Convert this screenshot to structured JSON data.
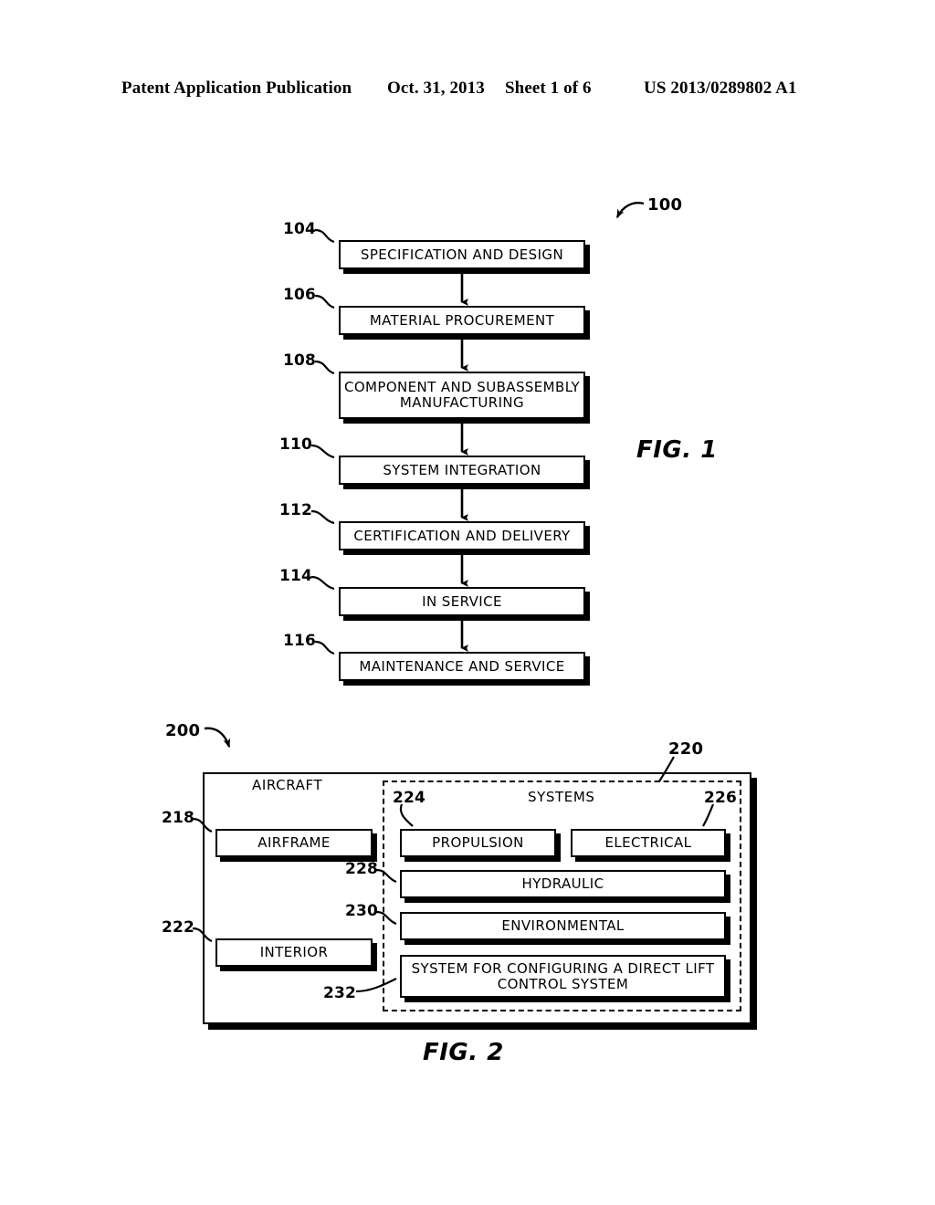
{
  "header": {
    "publication": "Patent Application Publication",
    "date": "Oct. 31, 2013",
    "sheet": "Sheet 1 of 6",
    "patent_number": "US 2013/0289802 A1"
  },
  "figure1": {
    "caption": "FIG. 1",
    "diagram_ref": "100",
    "steps": [
      {
        "ref": "104",
        "label": "SPECIFICATION AND DESIGN"
      },
      {
        "ref": "106",
        "label": "MATERIAL PROCUREMENT"
      },
      {
        "ref": "108",
        "label": "COMPONENT AND SUBASSEMBLY MANUFACTURING"
      },
      {
        "ref": "110",
        "label": "SYSTEM INTEGRATION"
      },
      {
        "ref": "112",
        "label": "CERTIFICATION AND DELIVERY"
      },
      {
        "ref": "114",
        "label": "IN SERVICE"
      },
      {
        "ref": "116",
        "label": "MAINTENANCE AND SERVICE"
      }
    ]
  },
  "figure2": {
    "caption": "FIG. 2",
    "diagram_ref": "200",
    "aircraft_label": "AIRCRAFT",
    "systems_label": "SYSTEMS",
    "systems_ref": "220",
    "blocks": [
      {
        "ref": "218",
        "label": "AIRFRAME"
      },
      {
        "ref": "222",
        "label": "INTERIOR"
      },
      {
        "ref": "224",
        "label": "PROPULSION"
      },
      {
        "ref": "226",
        "label": "ELECTRICAL"
      },
      {
        "ref": "228",
        "label": "HYDRAULIC"
      },
      {
        "ref": "230",
        "label": "ENVIRONMENTAL"
      },
      {
        "ref": "232",
        "label": "SYSTEM FOR CONFIGURING A DIRECT LIFT CONTROL SYSTEM"
      }
    ]
  }
}
